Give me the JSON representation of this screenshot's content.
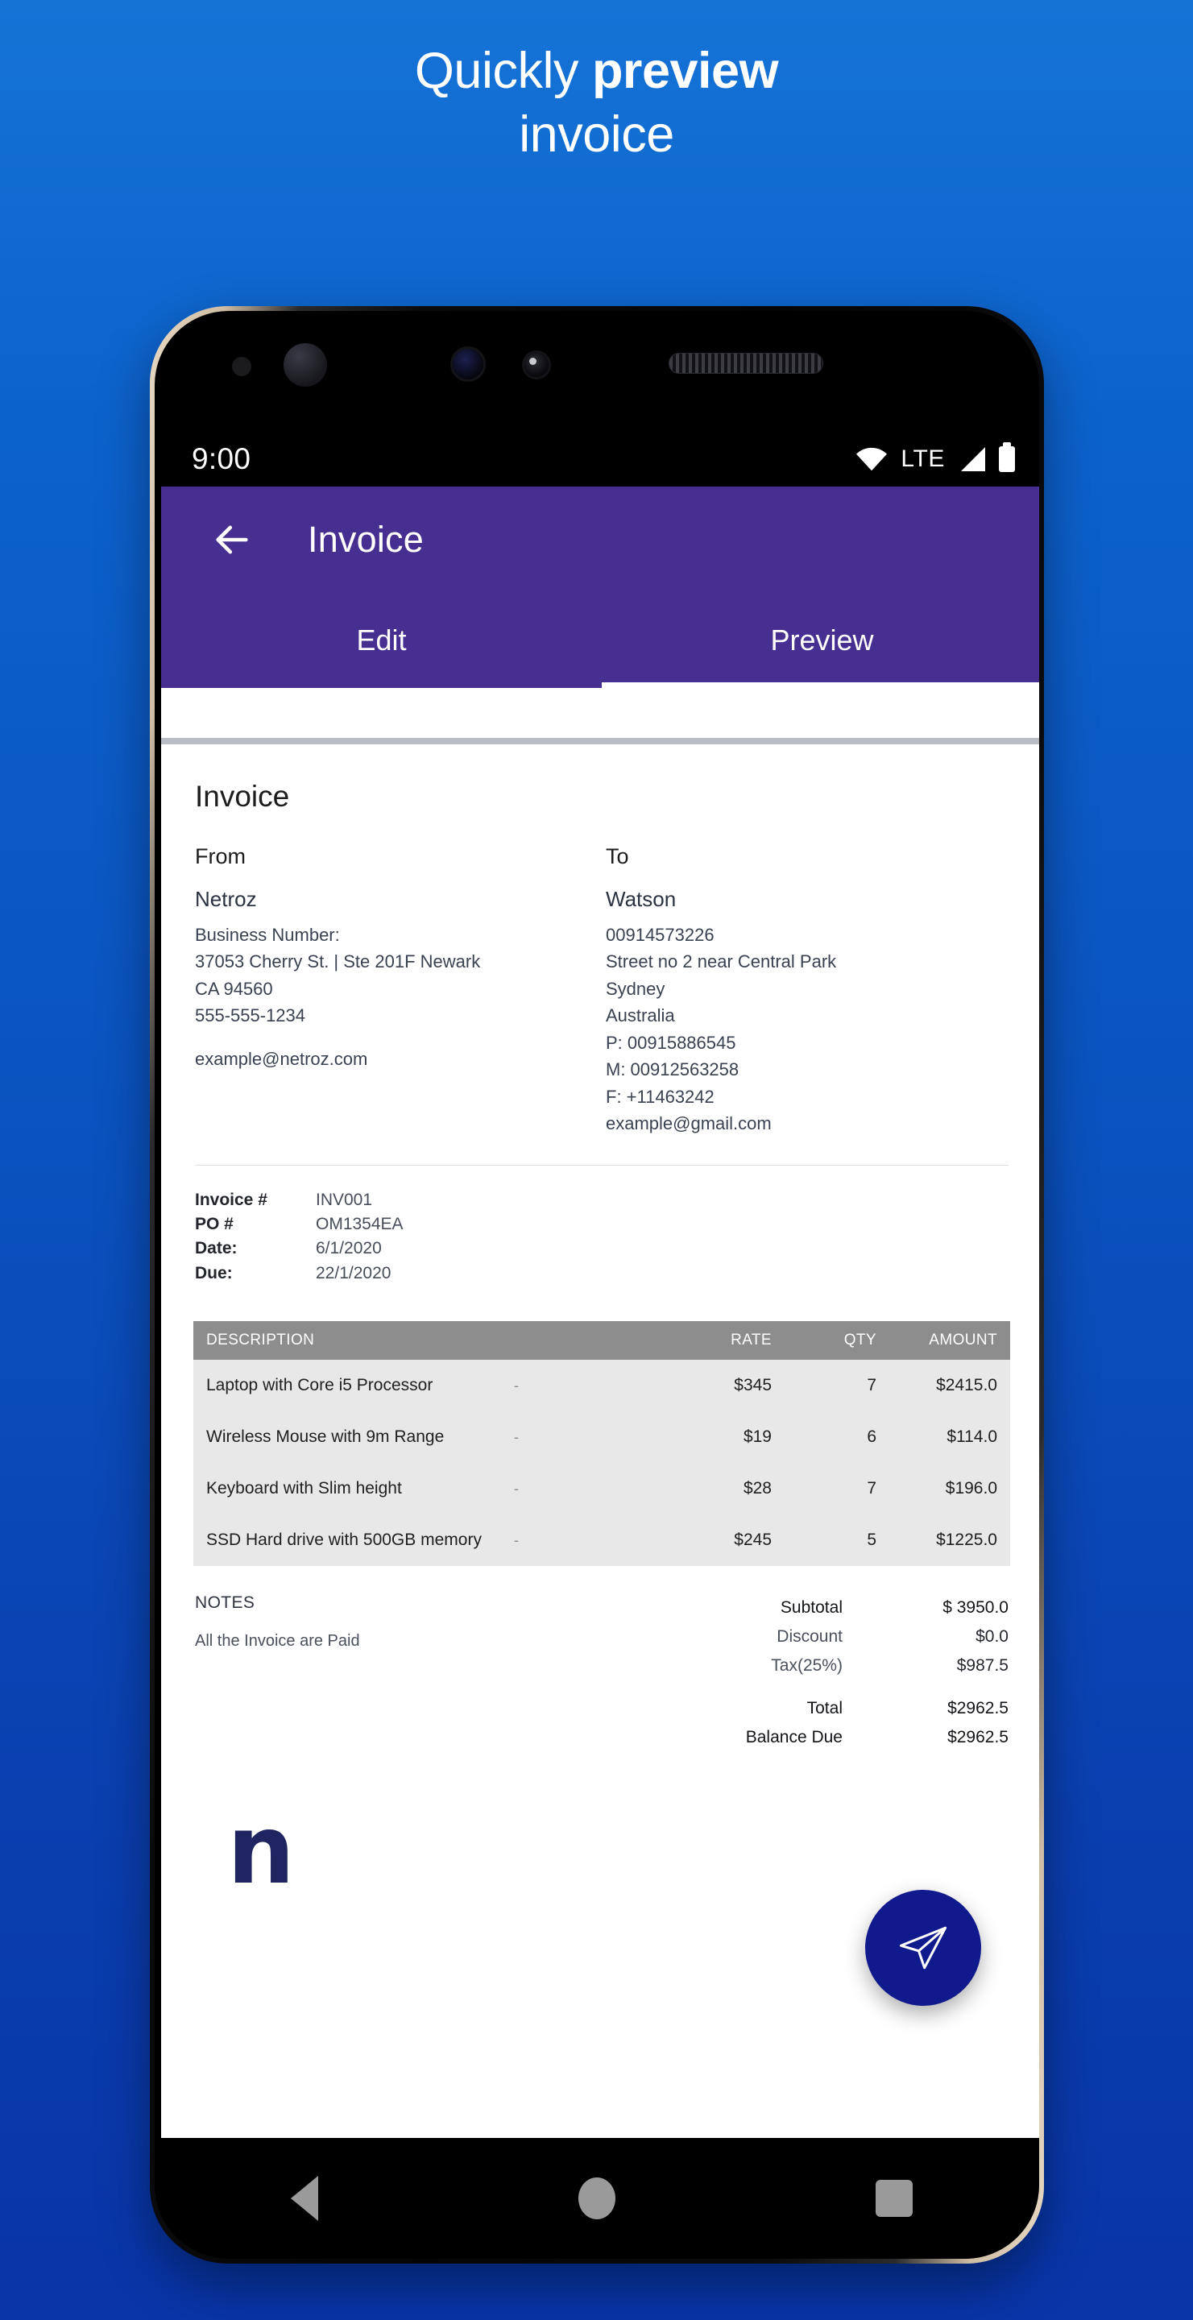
{
  "promo": {
    "line1_prefix": "Quickly ",
    "line1_strong": "preview",
    "line2": "invoice"
  },
  "statusbar": {
    "clock": "9:00",
    "network_label": "LTE",
    "icons": [
      "wifi-icon",
      "signal-icon",
      "battery-icon"
    ]
  },
  "appbar": {
    "back_icon": "back-arrow-icon",
    "title": "Invoice",
    "tabs": [
      {
        "label": "Edit",
        "active": false
      },
      {
        "label": "Preview",
        "active": true
      }
    ],
    "background": "#472f91"
  },
  "document": {
    "title": "Invoice",
    "from": {
      "label": "From",
      "name": "Netroz",
      "lines": [
        "Business Number:",
        "37053 Cherry St. | Ste 201F Newark",
        "CA 94560",
        "555-555-1234"
      ],
      "email": "example@netroz.com"
    },
    "to": {
      "label": "To",
      "name": "Watson",
      "lines": [
        "00914573226",
        "Street no 2 near Central Park",
        "Sydney",
        "Australia",
        "P: 00915886545",
        "M: 00912563258",
        "F: +11463242",
        "example@gmail.com"
      ]
    },
    "meta": [
      {
        "key": "Invoice #",
        "value": "INV001"
      },
      {
        "key": "PO #",
        "value": "OM1354EA"
      },
      {
        "key": "Date:",
        "value": "6/1/2020"
      },
      {
        "key": "Due:",
        "value": "22/1/2020"
      }
    ],
    "table": {
      "headers": [
        "DESCRIPTION",
        "RATE",
        "QTY",
        "AMOUNT"
      ],
      "rows": [
        {
          "description": "Laptop with Core i5 Processor",
          "dash": "-",
          "rate": "$345",
          "qty": "7",
          "amount": "$2415.0"
        },
        {
          "description": "Wireless Mouse with 9m Range",
          "dash": "-",
          "rate": "$19",
          "qty": "6",
          "amount": "$114.0"
        },
        {
          "description": "Keyboard with Slim height",
          "dash": "-",
          "rate": "$28",
          "qty": "7",
          "amount": "$196.0"
        },
        {
          "description": "SSD Hard drive with 500GB memory",
          "dash": "-",
          "rate": "$245",
          "qty": "5",
          "amount": "$1225.0"
        }
      ]
    },
    "notes": {
      "label": "NOTES",
      "text": "All the Invoice are Paid"
    },
    "summary": [
      {
        "label": "Subtotal",
        "value": "$ 3950.0",
        "emphasis": true
      },
      {
        "label": "Discount",
        "value": "$0.0",
        "emphasis": false
      },
      {
        "label": "Tax(25%)",
        "value": "$987.5",
        "emphasis": false
      },
      {
        "label": "Total",
        "value": "$2962.5",
        "emphasis": true
      },
      {
        "label": "Balance Due",
        "value": "$2962.5",
        "emphasis": true
      }
    ],
    "logo_letter": "n",
    "logo_color": "#1f2560"
  },
  "fab": {
    "icon": "send-icon",
    "color": "#101a8c"
  },
  "navbar": {
    "buttons": [
      "back-nav-icon",
      "home-nav-icon",
      "recents-nav-icon"
    ]
  }
}
